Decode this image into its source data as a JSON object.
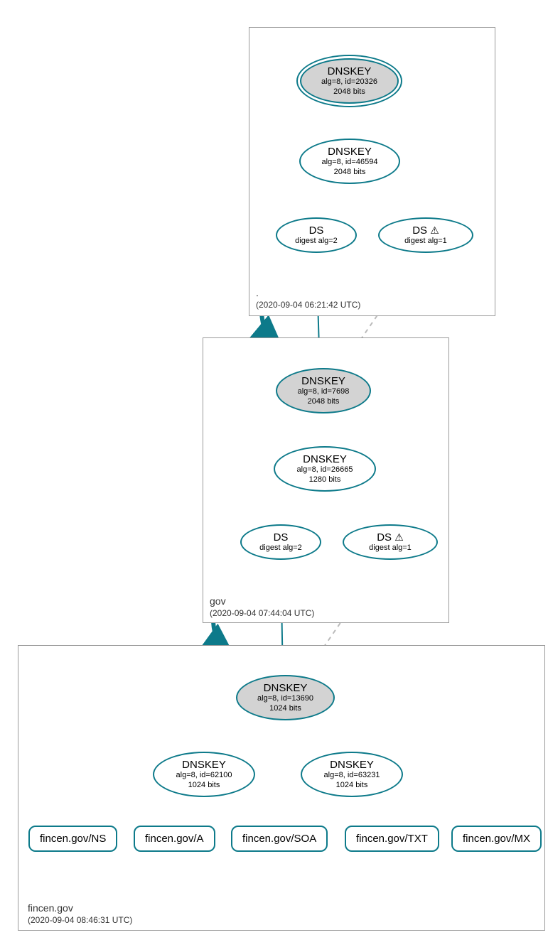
{
  "zones": {
    "root": {
      "name": ".",
      "timestamp": "(2020-09-04 06:21:42 UTC)"
    },
    "gov": {
      "name": "gov",
      "timestamp": "(2020-09-04 07:44:04 UTC)"
    },
    "fincen": {
      "name": "fincen.gov",
      "timestamp": "(2020-09-04 08:46:31 UTC)"
    }
  },
  "nodes": {
    "root_ksk": {
      "title": "DNSKEY",
      "line1": "alg=8, id=20326",
      "line2": "2048 bits"
    },
    "root_zsk": {
      "title": "DNSKEY",
      "line1": "alg=8, id=46594",
      "line2": "2048 bits"
    },
    "root_ds2": {
      "title": "DS",
      "line1": "digest alg=2"
    },
    "root_ds1": {
      "title": "DS",
      "line1": "digest alg=1",
      "warn": "⚠"
    },
    "gov_ksk": {
      "title": "DNSKEY",
      "line1": "alg=8, id=7698",
      "line2": "2048 bits"
    },
    "gov_zsk": {
      "title": "DNSKEY",
      "line1": "alg=8, id=26665",
      "line2": "1280 bits"
    },
    "gov_ds2": {
      "title": "DS",
      "line1": "digest alg=2"
    },
    "gov_ds1": {
      "title": "DS",
      "line1": "digest alg=1",
      "warn": "⚠"
    },
    "fincen_ksk": {
      "title": "DNSKEY",
      "line1": "alg=8, id=13690",
      "line2": "1024 bits"
    },
    "fincen_zsk1": {
      "title": "DNSKEY",
      "line1": "alg=8, id=62100",
      "line2": "1024 bits"
    },
    "fincen_zsk2": {
      "title": "DNSKEY",
      "line1": "alg=8, id=63231",
      "line2": "1024 bits"
    },
    "rr_ns": {
      "label": "fincen.gov/NS"
    },
    "rr_a": {
      "label": "fincen.gov/A"
    },
    "rr_soa": {
      "label": "fincen.gov/SOA"
    },
    "rr_txt": {
      "label": "fincen.gov/TXT"
    },
    "rr_mx": {
      "label": "fincen.gov/MX"
    }
  }
}
